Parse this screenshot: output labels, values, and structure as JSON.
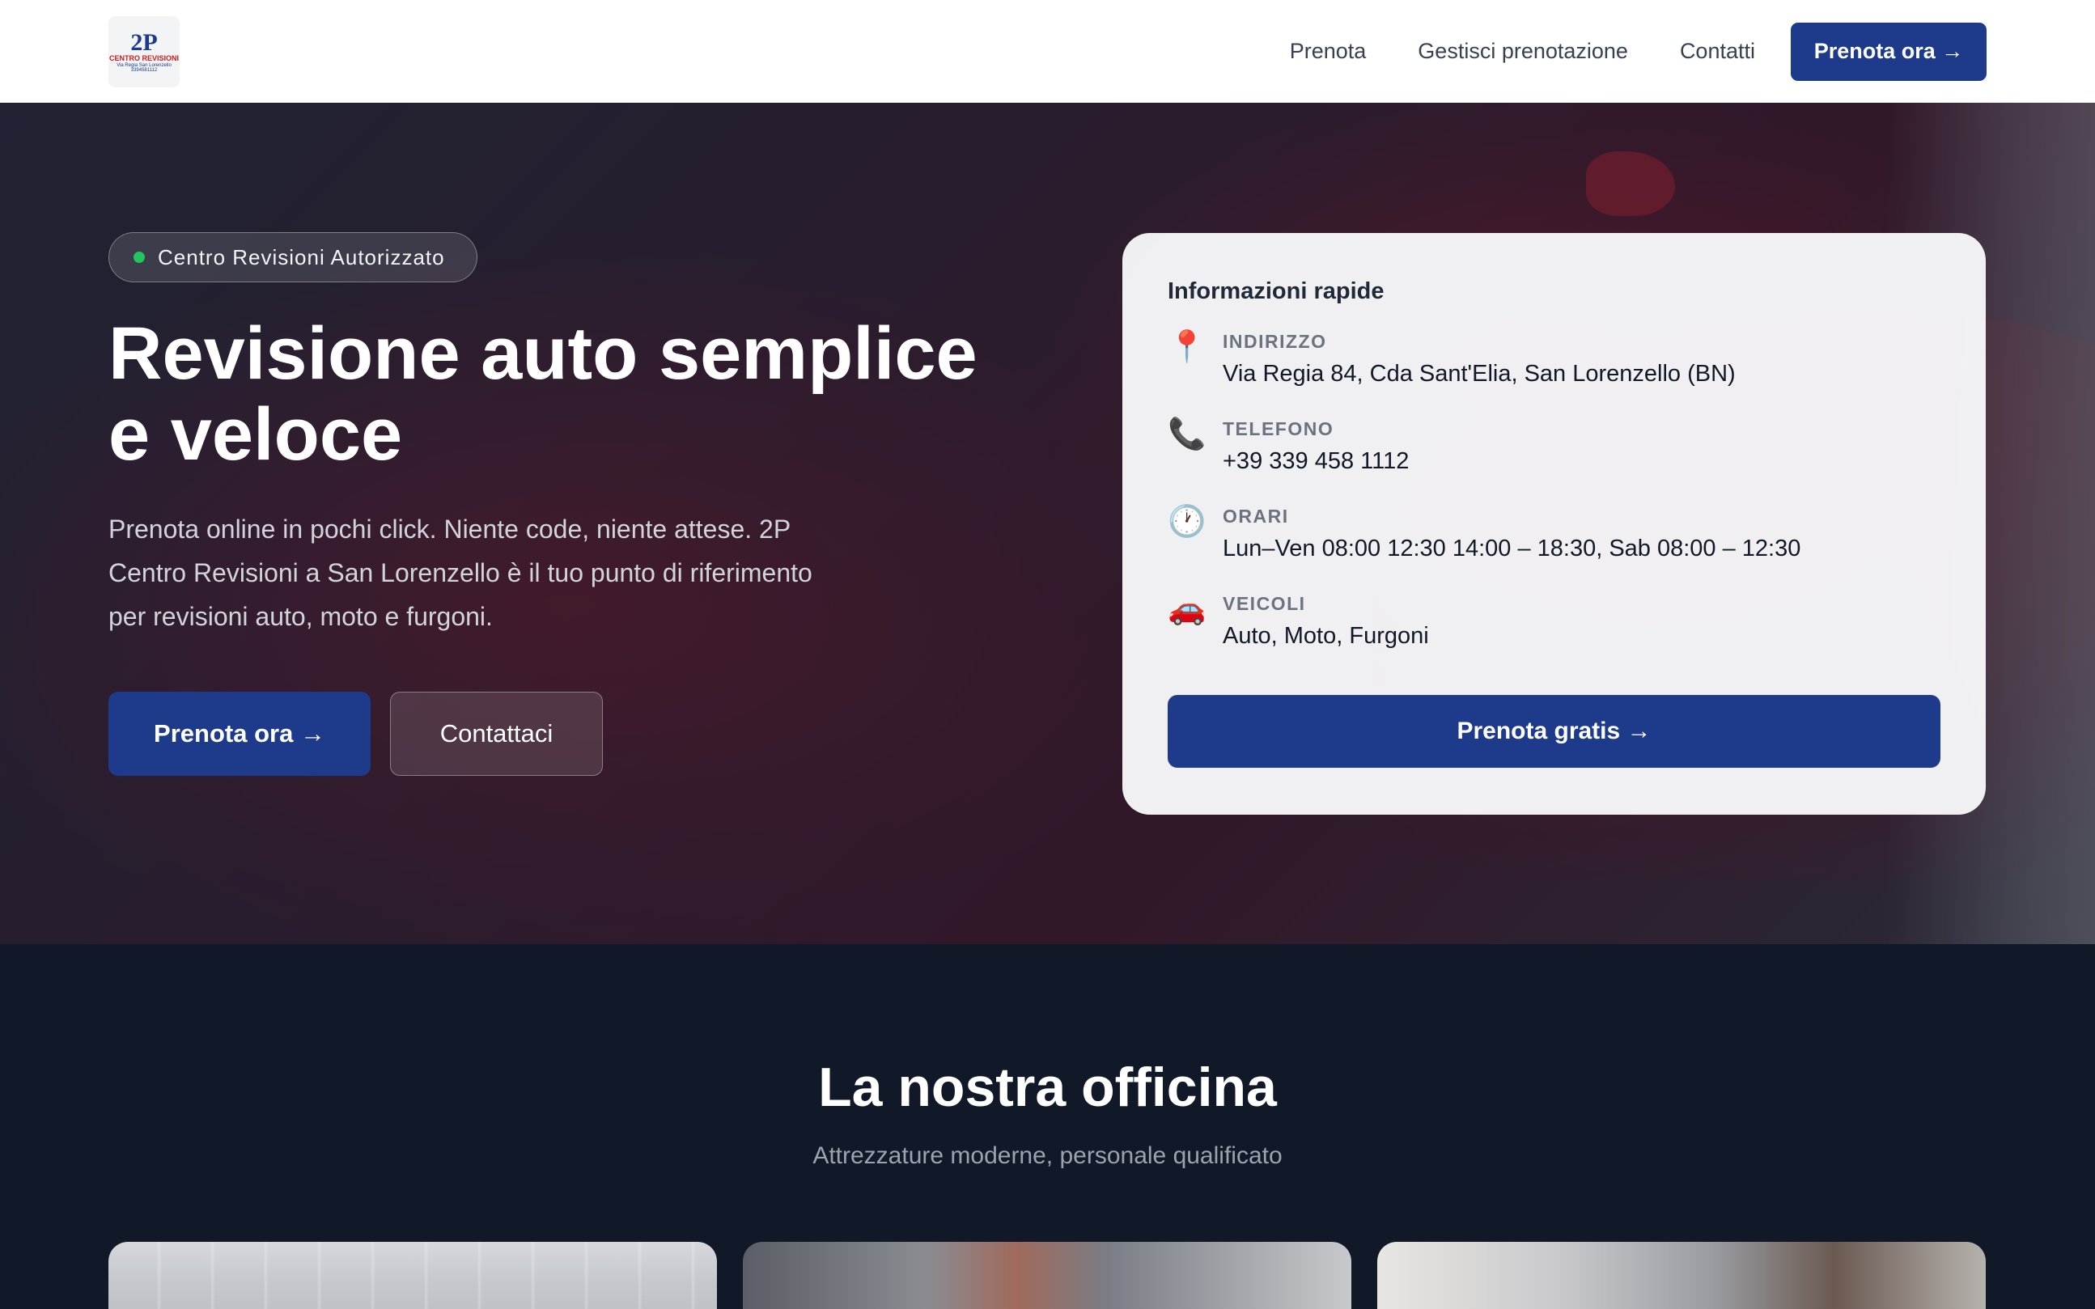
{
  "header": {
    "logo": {
      "main": "2P",
      "sub": "CENTRO REVISIONI",
      "address": "Via Regia San Lorenzello",
      "phone": "3394581112"
    },
    "nav": {
      "items": [
        "Prenota",
        "Gestisci prenotazione",
        "Contatti"
      ],
      "cta_label": "Prenota ora →"
    }
  },
  "hero": {
    "badge": "Centro Revisioni Autorizzato",
    "title_line1": "Revisione auto semplice",
    "title_line2": "e veloce",
    "subtitle": "Prenota online in pochi click. Niente code, niente attese. 2P Centro Revisioni a San Lorenzello è il tuo punto di riferimento per revisioni auto, moto e furgoni.",
    "primary_button": "Prenota ora →",
    "secondary_button": "Contattaci"
  },
  "info_card": {
    "title": "Informazioni rapide",
    "rows": [
      {
        "icon": "map-pin-icon",
        "glyph": "📍",
        "label": "INDIRIZZO",
        "value": "Via Regia 84, Cda Sant'Elia, San Lorenzello (BN)"
      },
      {
        "icon": "phone-icon",
        "glyph": "📞",
        "label": "TELEFONO",
        "value": "+39 339 458 1112"
      },
      {
        "icon": "clock-icon",
        "glyph": "🕐",
        "label": "ORARI",
        "value": "Lun–Ven 08:00 12:30 14:00 – 18:30, Sab 08:00 – 12:30"
      },
      {
        "icon": "car-icon",
        "glyph": "🚗",
        "label": "VEICOLI",
        "value": "Auto, Moto, Furgoni"
      }
    ],
    "cta_label": "Prenota gratis →"
  },
  "section": {
    "title": "La nostra officina",
    "subtitle": "Attrezzature moderne, personale qualificato"
  },
  "colors": {
    "brand": "#1e3a8a",
    "dark_bg": "#111827",
    "badge_dot": "#22c55e"
  }
}
